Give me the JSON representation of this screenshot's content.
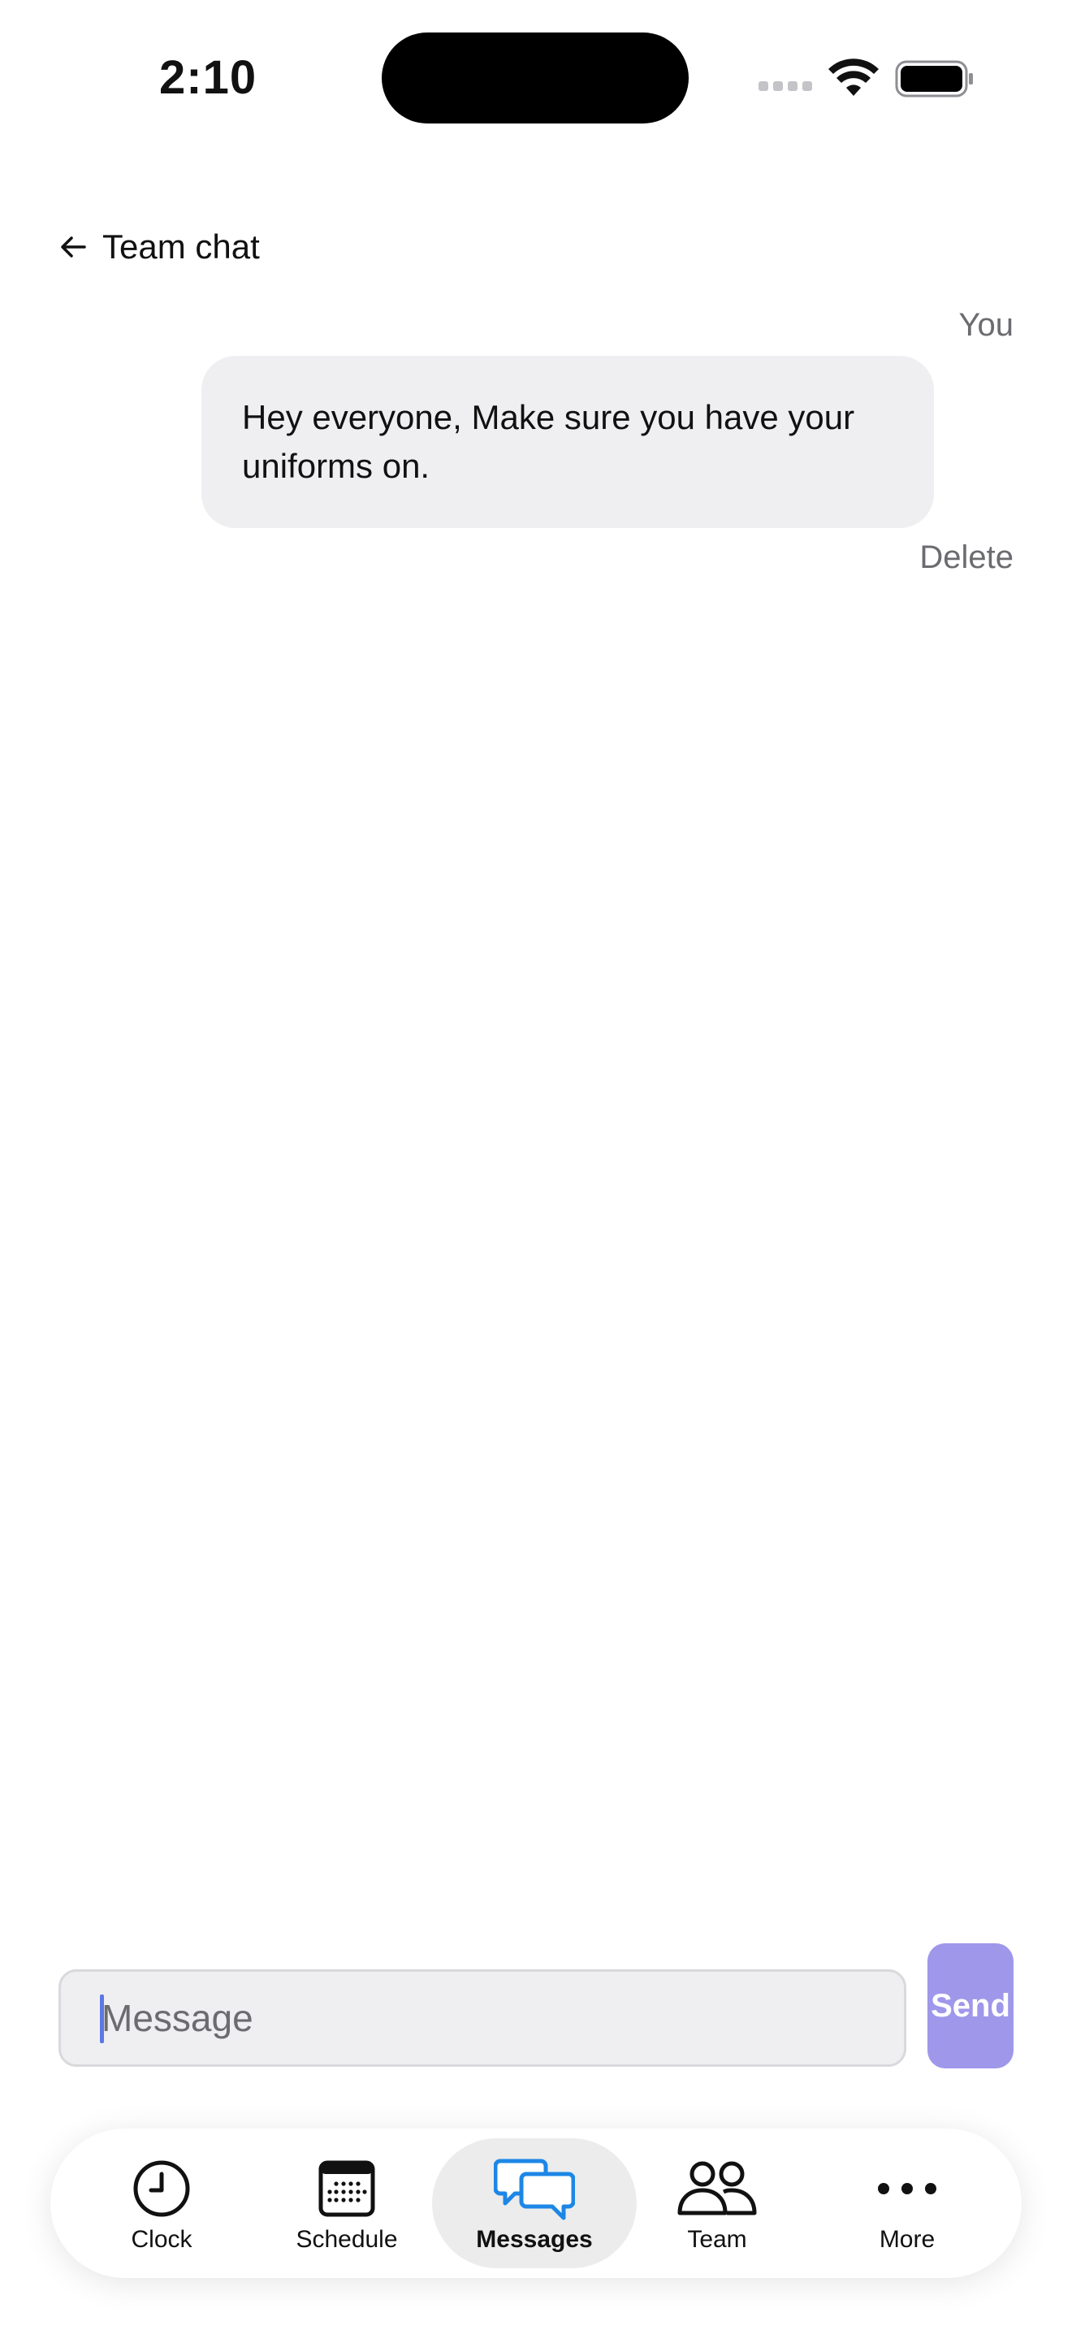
{
  "status_bar": {
    "time": "2:10"
  },
  "header": {
    "title": "Team chat"
  },
  "messages": [
    {
      "sender": "You",
      "text": "Hey everyone, Make sure you have your uniforms on.",
      "action": "Delete"
    }
  ],
  "composer": {
    "placeholder": "Message",
    "value": "",
    "send_label": "Send"
  },
  "tabs": [
    {
      "label": "Clock",
      "icon": "clock-icon",
      "active": false
    },
    {
      "label": "Schedule",
      "icon": "calendar-icon",
      "active": false
    },
    {
      "label": "Messages",
      "icon": "chat-bubbles-icon",
      "active": true
    },
    {
      "label": "Team",
      "icon": "people-icon",
      "active": false
    },
    {
      "label": "More",
      "icon": "more-dots-icon",
      "active": false
    }
  ],
  "colors": {
    "accent": "#1d87e6",
    "send_button": "#9f97ea",
    "bubble": "#efeff1",
    "secondary_text": "#6b6b70"
  }
}
